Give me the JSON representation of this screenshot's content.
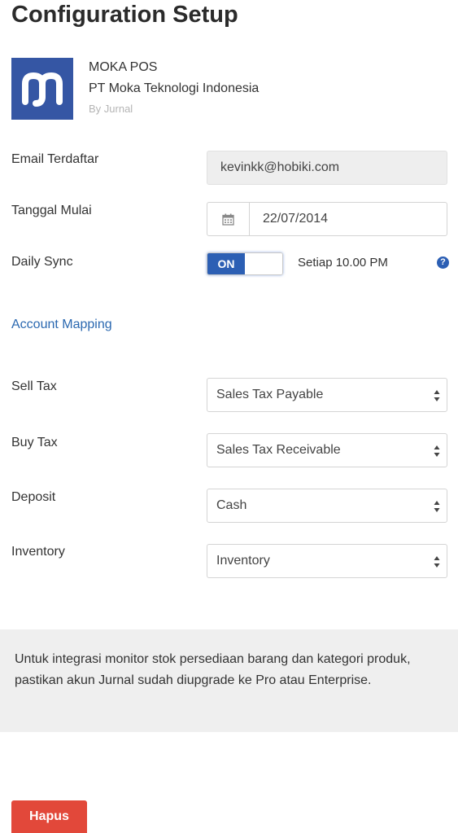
{
  "page": {
    "title": "Configuration Setup"
  },
  "app": {
    "name": "MOKA POS",
    "company": "PT Moka Teknologi Indonesia",
    "by": "By Jurnal",
    "logo_icon": "moka-logo-icon",
    "logo_color": "#3556a4"
  },
  "form": {
    "email": {
      "label": "Email Terdaftar",
      "value": "kevinkk@hobiki.com"
    },
    "start_date": {
      "label": "Tanggal Mulai",
      "value": "22/07/2014",
      "icon": "calendar-icon"
    },
    "daily_sync": {
      "label": "Daily Sync",
      "toggle": "ON",
      "schedule": "Setiap 10.00 PM",
      "help_icon": "question-icon"
    }
  },
  "account_mapping": {
    "heading": "Account Mapping",
    "rows": [
      {
        "label": "Sell Tax",
        "value": "Sales Tax Payable"
      },
      {
        "label": "Buy Tax",
        "value": "Sales Tax Receivable"
      },
      {
        "label": "Deposit",
        "value": "Cash"
      },
      {
        "label": "Inventory",
        "value": "Inventory"
      }
    ]
  },
  "notice": {
    "text": "Untuk integrasi monitor stok persediaan barang dan kategori produk, pastikan akun Jurnal sudah diupgrade ke Pro atau Enterprise."
  },
  "actions": {
    "delete_label": "Hapus"
  },
  "colors": {
    "primary": "#2c5fb4",
    "link": "#2a68b0",
    "danger": "#e2483a"
  }
}
